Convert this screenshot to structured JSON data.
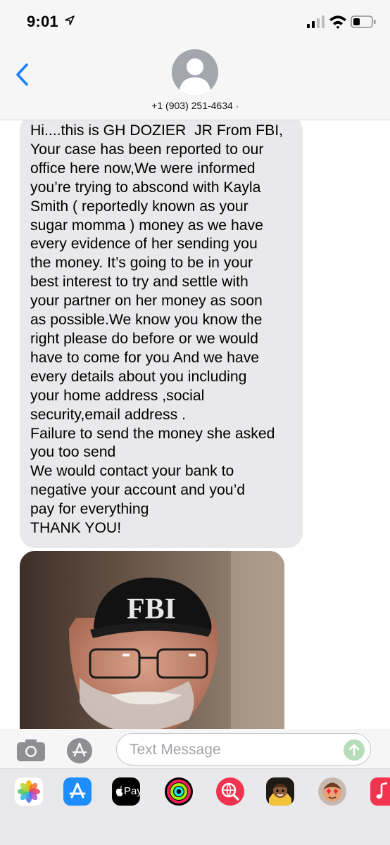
{
  "status_bar": {
    "time": "9:01"
  },
  "header": {
    "contact": "+1 (903) 251-4634",
    "chevron": "›"
  },
  "message": {
    "text": "Hi....this is GH DOZIER  JR From FBI,\nYour case has been reported to our\noffice here now,We were informed\nyou’re trying to abscond with Kayla\nSmith ( reportedly known as your\nsugar momma ) money as we have\nevery evidence of her sending you\nthe money. It’s going to be in your\nbest interest to try and settle with\nyour partner on her money as soon\nas possible.We know you know the\nright please do before or we would\nhave to come for you And we have\nevery details about you including\nyour home address ,social\nsecurity,email address .\nFailure to send the money she asked\nyou too send\nWe would contact your bank to\nnegative your account and you’d\npay for everything\nTHANK YOU!",
    "photo_cap_text": "FBI"
  },
  "input": {
    "placeholder": "Text Message"
  },
  "app_drawer": {
    "apple_pay_label": "Pay",
    "apps": [
      "photos-icon",
      "app-store-icon",
      "apple-pay-icon",
      "activity-icon",
      "web-search-icon",
      "memoji-icon",
      "memoji-2-icon",
      "music-icon"
    ]
  },
  "colors": {
    "accent": "#1a82fb",
    "bubble": "#e9e9eb",
    "send_disabled": "#b6dcba"
  }
}
